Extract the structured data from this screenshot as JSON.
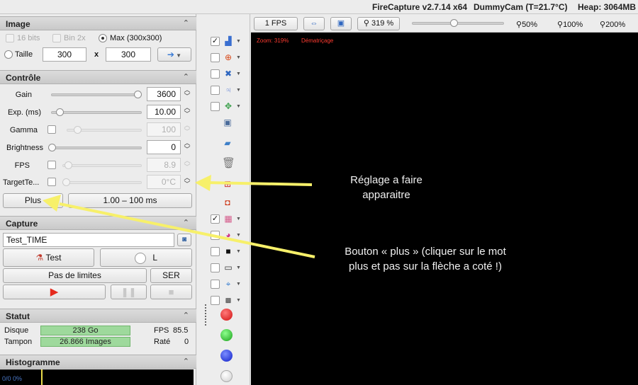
{
  "titlebar": {
    "app": "FireCapture v2.7.14 x64",
    "camera": "DummyCam (T=21.7°C)",
    "heap": "Heap: 3064MB"
  },
  "image": {
    "title": "Image",
    "bits16": "16 bits",
    "bin2x": "Bin 2x",
    "max": "Max (300x300)",
    "size_label": "Taille",
    "width": "300",
    "times": "x",
    "height": "300"
  },
  "controle": {
    "title": "Contrôle",
    "rows": [
      {
        "label": "Gain",
        "value": "3600",
        "level": 1.0
      },
      {
        "label": "Exp. (ms)",
        "value": "10.00",
        "level": 0.06
      },
      {
        "label": "Gamma",
        "value": "100",
        "level": 0.1
      },
      {
        "label": "Brightness",
        "value": "0",
        "level": 0.0
      },
      {
        "label": "FPS",
        "value": "8.9",
        "level": 0.03
      },
      {
        "label": "TargetTe...",
        "value": "0°C",
        "level": 0.0
      }
    ],
    "plus": "Plus",
    "range": "1.00 – 100 ms"
  },
  "capture": {
    "title": "Capture",
    "filename": "Test_TIME",
    "test": "Test",
    "l": "L",
    "limits": "Pas de limites",
    "format": "SER"
  },
  "statut": {
    "title": "Statut",
    "disk_label": "Disque",
    "disk_value": "238 Go",
    "buffer_label": "Tampon",
    "buffer_value": "26.866  Images",
    "fps_label": "FPS",
    "fps_value": "85.5",
    "rate_label": "Raté",
    "rate_value": "0"
  },
  "histogramme": {
    "title": "Histogramme",
    "value": "0/0 0%"
  },
  "toolbar": {
    "fps": "1 FPS",
    "zoom": "319 %",
    "z50": "50%",
    "z100": "100%",
    "z200": "200%"
  },
  "video": {
    "zoom": "Zoom: 319%",
    "mode": "Dématriçage"
  },
  "annotations": {
    "a1": "Réglage a faire\napparaitre",
    "a2": "Bouton « plus » (cliquer sur le mot\nplus et pas sur la flèche a coté !)"
  },
  "colors": {
    "arrow": "#f7f06a",
    "overlay": "#ff3b30"
  }
}
